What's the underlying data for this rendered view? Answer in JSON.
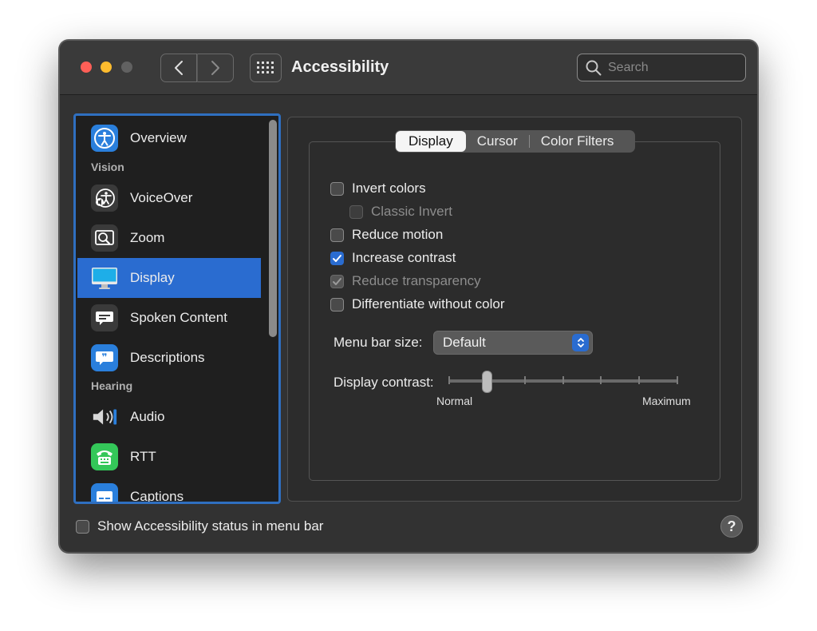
{
  "window": {
    "title": "Accessibility",
    "search_placeholder": "Search"
  },
  "sidebar": {
    "items": [
      {
        "label": "Overview",
        "icon": "accessibility-icon",
        "color": "#2a7fdc"
      },
      {
        "section": "Vision"
      },
      {
        "label": "VoiceOver",
        "icon": "voiceover-icon",
        "color": "#3a3a3a"
      },
      {
        "label": "Zoom",
        "icon": "zoom-icon",
        "color": "#3a3a3a"
      },
      {
        "label": "Display",
        "icon": "display-icon",
        "color": "#1eaee8",
        "selected": true
      },
      {
        "label": "Spoken Content",
        "icon": "spoken-content-icon",
        "color": "#3a3a3a"
      },
      {
        "label": "Descriptions",
        "icon": "descriptions-icon",
        "color": "#2a7fdc"
      },
      {
        "section": "Hearing"
      },
      {
        "label": "Audio",
        "icon": "audio-icon",
        "color": "#2a2a2a"
      },
      {
        "label": "RTT",
        "icon": "rtt-icon",
        "color": "#34c759"
      },
      {
        "label": "Captions",
        "icon": "captions-icon",
        "color": "#2a7fdc"
      }
    ],
    "sections": {
      "vision": "Vision",
      "hearing": "Hearing"
    }
  },
  "tabs": [
    {
      "label": "Display",
      "active": true
    },
    {
      "label": "Cursor",
      "active": false
    },
    {
      "label": "Color Filters",
      "active": false
    }
  ],
  "options": {
    "invert_colors": {
      "label": "Invert colors",
      "checked": false
    },
    "classic_invert": {
      "label": "Classic Invert",
      "checked": false,
      "disabled": true
    },
    "reduce_motion": {
      "label": "Reduce motion",
      "checked": false
    },
    "increase_contrast": {
      "label": "Increase contrast",
      "checked": true
    },
    "reduce_transparency": {
      "label": "Reduce transparency",
      "checked": true,
      "disabled": true
    },
    "differentiate": {
      "label": "Differentiate without color",
      "checked": false
    }
  },
  "menu_bar_size": {
    "label": "Menu bar size:",
    "value": "Default"
  },
  "display_contrast": {
    "label": "Display contrast:",
    "min_label": "Normal",
    "max_label": "Maximum",
    "value_fraction": 0.17
  },
  "footer": {
    "status_label": "Show Accessibility status in menu bar",
    "status_checked": false,
    "help_label": "?"
  },
  "colors": {
    "accent": "#2a6cd0",
    "close": "#fe5f57",
    "minimize": "#febc2e"
  }
}
